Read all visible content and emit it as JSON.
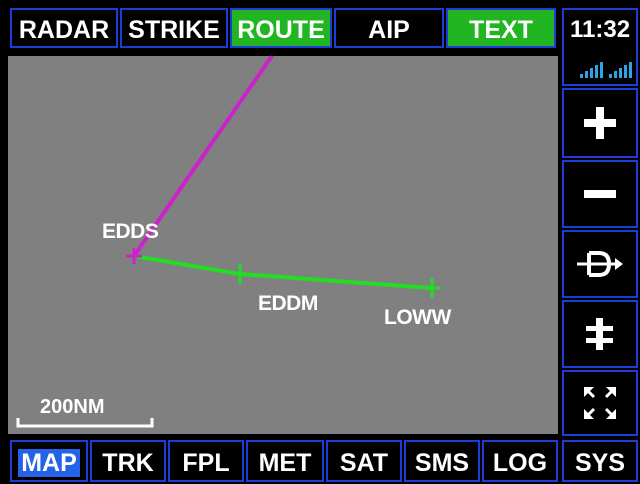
{
  "top_tabs": [
    {
      "label": "RADAR",
      "active": false
    },
    {
      "label": "STRIKE",
      "active": false
    },
    {
      "label": "ROUTE",
      "active": true
    },
    {
      "label": "AIP",
      "active": false
    },
    {
      "label": "TEXT",
      "active": true
    }
  ],
  "clock": "11:32",
  "side_buttons": [
    {
      "name": "zoom-in-button",
      "icon": "plus-icon"
    },
    {
      "name": "zoom-out-button",
      "icon": "minus-icon"
    },
    {
      "name": "direct-to-button",
      "icon": "direct-to-icon"
    },
    {
      "name": "nearest-airport-button",
      "icon": "airport-icon"
    },
    {
      "name": "fullscreen-button",
      "icon": "fullscreen-icon"
    }
  ],
  "map": {
    "waypoints": {
      "edds": "EDDS",
      "eddm": "EDDM",
      "loww": "LOWW"
    },
    "scale": "200NM",
    "colors": {
      "route_active": "#cc22cc",
      "route_plan": "#22dd22",
      "background": "#808080"
    }
  },
  "bottom_tabs": [
    {
      "label": "MAP",
      "active": true
    },
    {
      "label": "TRK",
      "active": false
    },
    {
      "label": "FPL",
      "active": false
    },
    {
      "label": "MET",
      "active": false
    },
    {
      "label": "SAT",
      "active": false
    },
    {
      "label": "SMS",
      "active": false
    },
    {
      "label": "LOG",
      "active": false
    },
    {
      "label": "SYS",
      "active": false
    }
  ]
}
